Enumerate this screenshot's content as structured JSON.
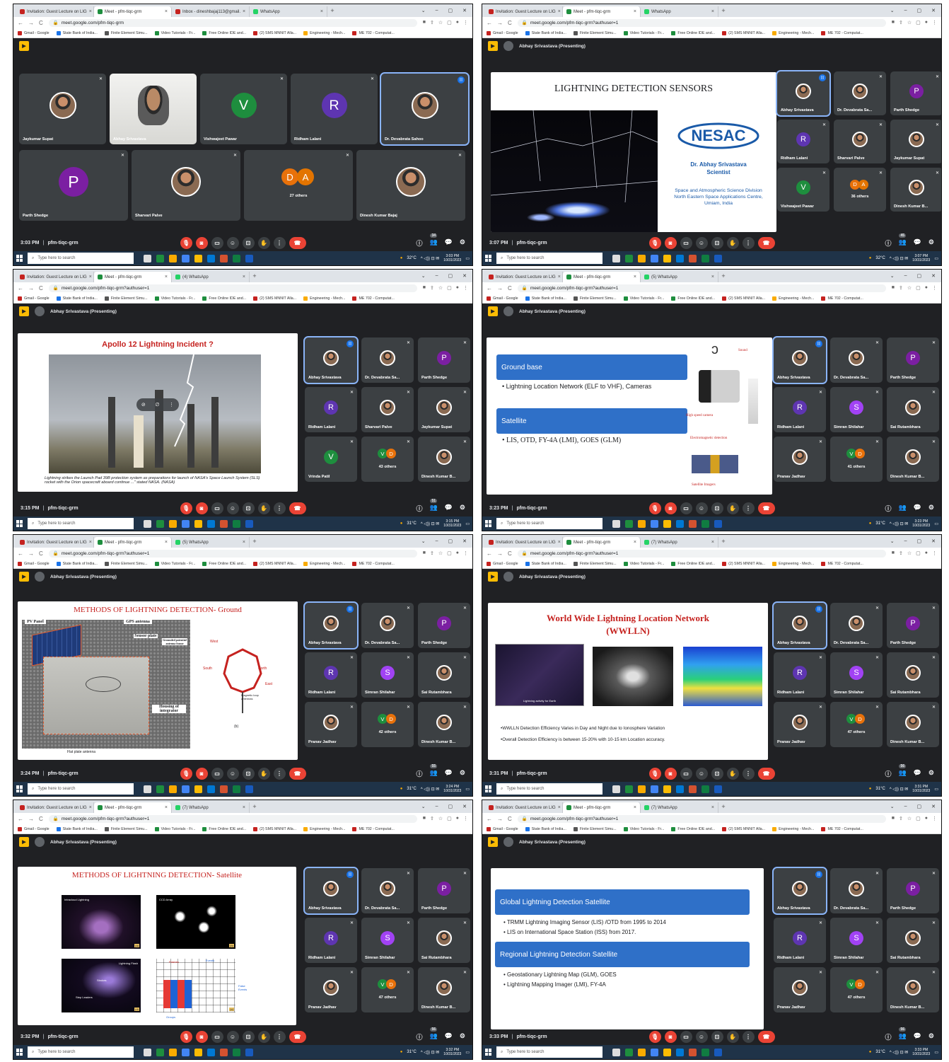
{
  "browser": {
    "tab_invitation": "Invitation: Guest Lecture on LIG",
    "tab_meet": "Meet - pfm-tiqc-grm",
    "tab_inbox": "Inbox - dineshbajaj113@gmail.",
    "tab_whatsapp": "WhatsApp",
    "tab_whatsapp_4": "(4) WhatsApp",
    "tab_whatsapp_5": "(5) WhatsApp",
    "tab_whatsapp_7": "(7) WhatsApp",
    "url_short": "meet.google.com/pfm-tiqc-grm",
    "url": "meet.google.com/pfm-tiqc-grm?authuser=1",
    "bookmarks": [
      "Gmail - Google",
      "State Bank of India...",
      "Finite Element Simu...",
      "Video Tutorials - Fr...",
      "Free Online IDE and...",
      "(2) SMS MNNIT Alla...",
      "Engineering - Mech...",
      "ME 702 - Computat..."
    ]
  },
  "meet": {
    "code": "pfm-tiqc-grm",
    "presenting": "Abhay Srivastava (Presenting)"
  },
  "taskbar": {
    "search": "Type here to search",
    "temp_32": "32°C",
    "temp_31": "31°C",
    "date": "10/31/2023"
  },
  "names": {
    "jaykumar": "Jaykumar Supat",
    "abhay": "Abhay Srivastava",
    "vishwajeet": "Vishwajeet Pawar",
    "ridham": "Ridham Lalani",
    "devabrata": "Dr. Devabrata Sahoo",
    "devabrata_short": "Dr. Devabrata Sa...",
    "parth": "Parth Shedge",
    "sharvari": "Sharvari Palve",
    "dinesh": "Dinesh Kumar Bajaj",
    "dinesh_short": "Dinesh Kumar B...",
    "vrinda": "Vrinda Patil",
    "simran": "Simran Shilahar",
    "sai": "Sai Rutambhara",
    "pranav": "Pranav Jadhav"
  },
  "panels": [
    {
      "time": "3:03 PM",
      "clock": "3:03 PM",
      "count": "34",
      "others": "27 others"
    },
    {
      "time": "3:07 PM",
      "clock": "3:07 PM",
      "count": "45",
      "others": "36 others"
    },
    {
      "time": "3:15 PM",
      "clock": "3:15 PM",
      "count": "51",
      "others": "43 others"
    },
    {
      "time": "3:23 PM",
      "clock": "3:23 PM",
      "count": "",
      "others": "41 others"
    },
    {
      "time": "3:24 PM",
      "clock": "3:24 PM",
      "count": "55",
      "others": "42 others"
    },
    {
      "time": "3:31 PM",
      "clock": "3:31 PM",
      "count": "56",
      "others": "47 others"
    },
    {
      "time": "3:32 PM",
      "clock": "3:32 PM",
      "count": "56",
      "others": "47 others"
    },
    {
      "time": "3:33 PM",
      "clock": "3:33 PM",
      "count": "56",
      "others": "47 others"
    }
  ],
  "slides": {
    "s1": {
      "title": "LIGHTNING DETECTION SENSORS",
      "logo": "NESAC",
      "author": "Dr. Abhay Srivastava",
      "role": "Scientist",
      "division": "Space and Atmospheric Science Division",
      "centre": "North Eastern Space Applications Centre,",
      "place": "Umiam, India"
    },
    "s2": {
      "title": "Apollo 12 Lightning Incident ?",
      "caption": "Lightning strikes the Launch Pad 39B protection system as preparations for launch of NASA's Space Launch System (SLS) rocket with the Orion spacecraft aboard continue ...\" stated NASA. (NASA)"
    },
    "s3": {
      "h1": "Ground base",
      "b1": "Lightning Location Network (ELF to VHF), Cameras",
      "h2": "Satellite",
      "b2": "LIS, OTD, FY-4A (LMI), GOES (GLM)",
      "sound": "Sound",
      "camera": "High speed camera",
      "em": "Electromagnetic detection",
      "sat": "Satellite Imagers"
    },
    "s4": {
      "title": "METHODS OF LIGHTNING DETECTION- Ground",
      "pv": "PV Panel",
      "gps": "GPS antenna",
      "sensor": "Sensor plate",
      "grounded": "Grounded potential antenna frame",
      "housing": "Housing of integrator",
      "flat": "Flat plate antenna",
      "west": "West",
      "east": "East",
      "south": "South",
      "north": "North",
      "loop": "Magnetic loop antennas",
      "b": "(b)"
    },
    "s5": {
      "title": "World Wide Lightning Location Network",
      "sub": "(WWLLN)",
      "img1": "Lightning activity for Earth",
      "b1": "•WWLLN Detection Efficiency Varies in Day and Night due to Ionosphere Variation",
      "b2": "•Overall Detection Efficiency is between 15-20% with 10-15 km Location accuracy."
    },
    "s6": {
      "title": "METHODS OF LIGHTNING DETECTION- Satellite",
      "intra": "Intracloud Lightning",
      "ccd": "CCD Array",
      "flash": "Lightning Flash",
      "strokes": "Strokes",
      "step": "Step Leaders",
      "flashes": "Flashes",
      "events": "Events",
      "groups": "Groups",
      "false": "False Events",
      "a": "(a)",
      "b": "(b)",
      "c": "(c)",
      "d": "(d)"
    },
    "s7": {
      "h1": "Global Lightning Detection Satellite",
      "b1": "TRMM Lightning Imaging Sensor (LIS) /OTD from 1995 to 2014",
      "b2": "LIS on International Space Station (ISS) from 2017.",
      "h2": "Regional Lightning Detection Satellite",
      "b3": "Geostationary Lightning Map (GLM), GOES",
      "b4": "Lightning Mapping Imager (LMI), FY-4A"
    }
  },
  "colors": {
    "meet_bg": "#202124",
    "tile": "#3c4043",
    "red": "#ea4335",
    "blue": "#2f70c8",
    "speaking": "#8ab4f8",
    "nesac": "#1a5aa8"
  },
  "icons": [
    "search-icon",
    "mic-off-icon",
    "camera-off-icon",
    "captions-icon",
    "emoji-icon",
    "present-icon",
    "raise-hand-icon",
    "more-icon",
    "end-call-icon",
    "info-icon",
    "people-icon",
    "chat-icon",
    "activities-icon",
    "windows-icon",
    "close-icon",
    "star-icon",
    "refresh-icon"
  ]
}
